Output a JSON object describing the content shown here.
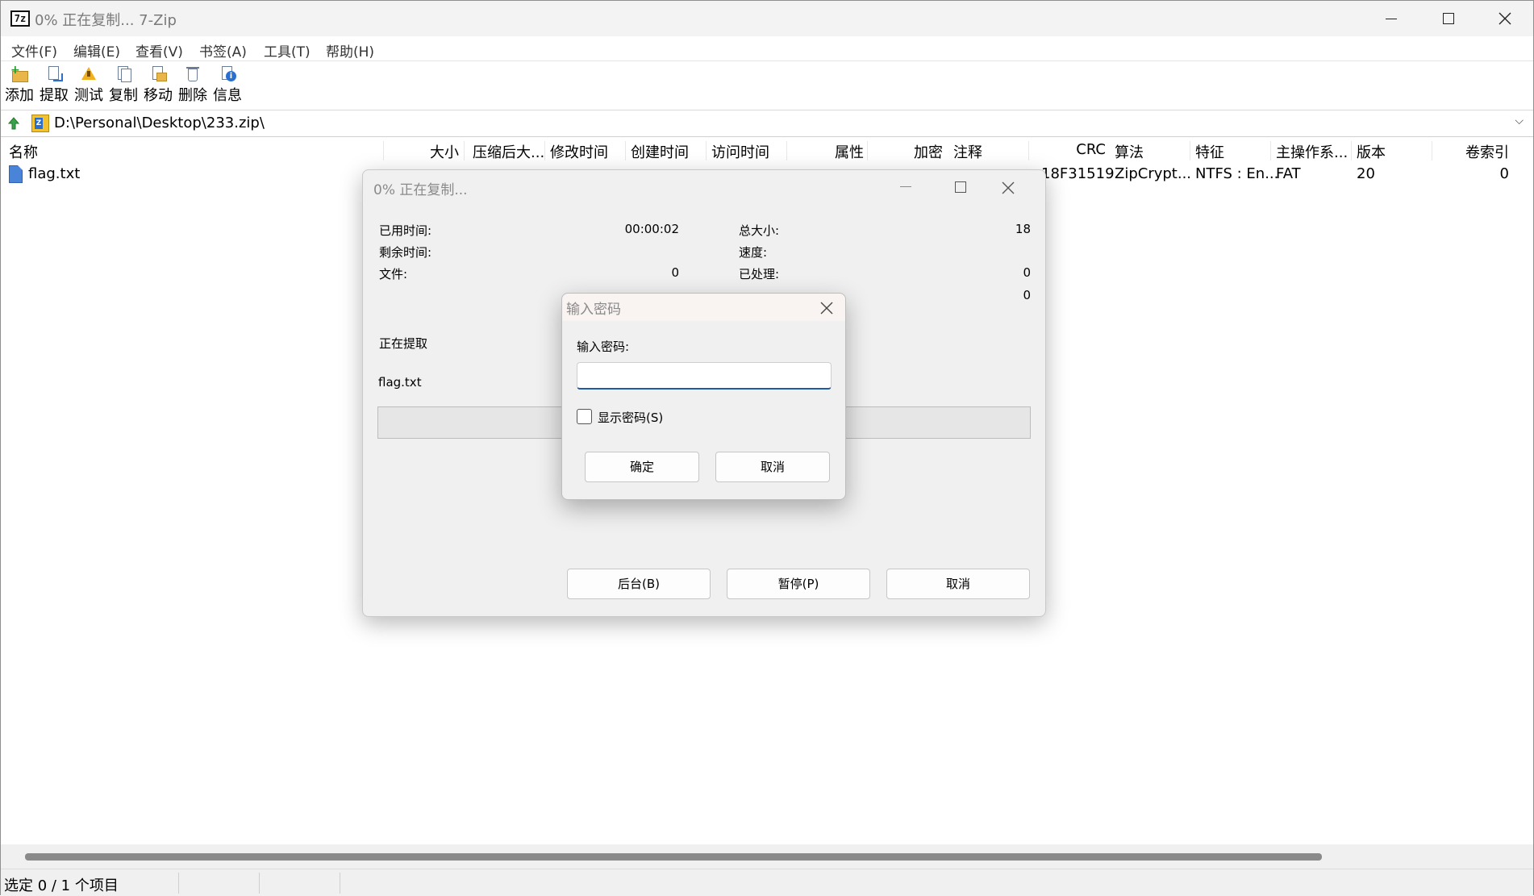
{
  "window": {
    "title": "0% 正在复制... 7-Zip",
    "app_icon_text": "7z"
  },
  "menu": [
    "文件(F)",
    "编辑(E)",
    "查看(V)",
    "书签(A)",
    "工具(T)",
    "帮助(H)"
  ],
  "toolbar": {
    "add": "添加",
    "extract": "提取",
    "test": "测试",
    "copy": "复制",
    "move": "移动",
    "delete": "删除",
    "info": "信息"
  },
  "address": {
    "path": "D:\\Personal\\Desktop\\233.zip\\",
    "dropdown_glyph": "⌵"
  },
  "columns": {
    "name": "名称",
    "size": "大小",
    "packed_size": "压缩后大...",
    "modified": "修改时间",
    "created": "创建时间",
    "accessed": "访问时间",
    "attributes": "属性",
    "encrypted": "加密",
    "comment": "注释",
    "crc": "CRC",
    "method": "算法",
    "characteristics": "特征",
    "host_os": "主操作系...",
    "version": "版本",
    "volume_index": "卷索引"
  },
  "files": [
    {
      "name": "flag.txt",
      "crc": "18F31519",
      "method": "ZipCrypt...",
      "characteristics": "NTFS : En...",
      "host_os": "FAT",
      "version": "20",
      "volume_index": "0"
    }
  ],
  "status": {
    "selection": "选定 0 / 1 个项目"
  },
  "progress_dialog": {
    "title": "0% 正在复制...",
    "elapsed_label": "已用时间:",
    "elapsed_value": "00:00:02",
    "remaining_label": "剩余时间:",
    "files_label": "文件:",
    "files_value": "0",
    "total_size_label": "总大小:",
    "total_size_value": "18",
    "speed_label": "速度:",
    "processed_label": "已处理:",
    "processed_value": "0",
    "packed_value": "0",
    "operation": "正在提取",
    "current_file": "flag.txt",
    "progress_fraction": 0,
    "background_button": "后台(B)",
    "pause_button": "暂停(P)",
    "cancel_button": "取消"
  },
  "password_dialog": {
    "title": "输入密码",
    "prompt": "输入密码:",
    "value": "",
    "show_password": "显示密码(S)",
    "show_password_checked": false,
    "ok": "确定",
    "cancel": "取消"
  }
}
